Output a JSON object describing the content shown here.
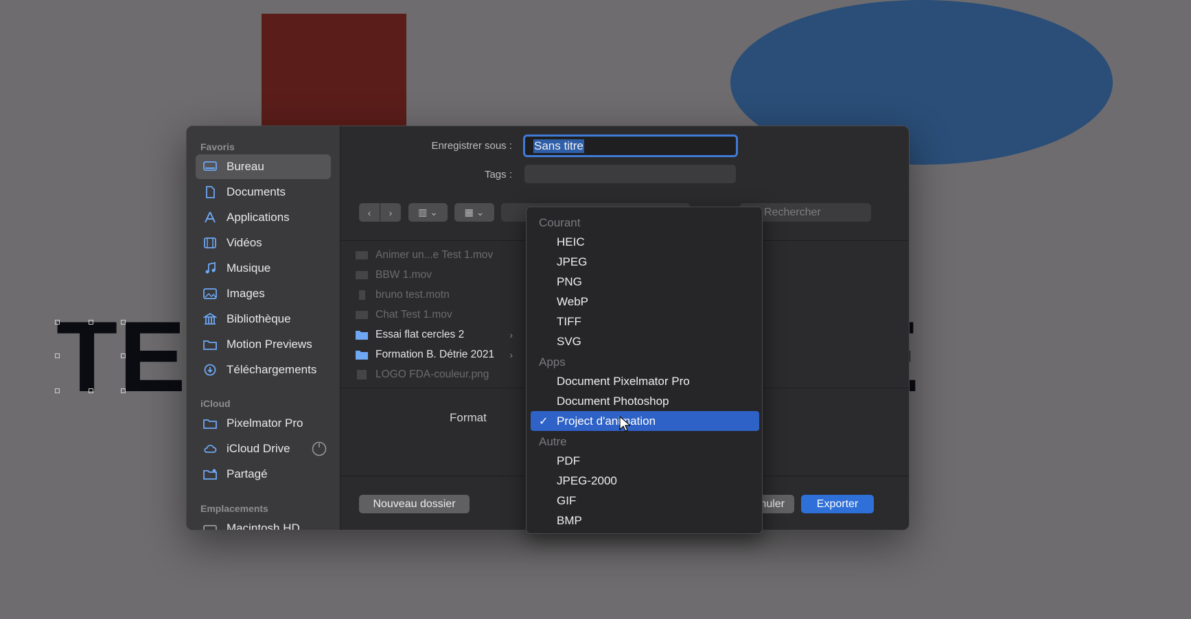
{
  "background": {
    "text_left": "TE",
    "text_right": "ME"
  },
  "dialog": {
    "save_as_label": "Enregistrer sous :",
    "save_as_value": "Sans titre",
    "tags_label": "Tags :",
    "search_placeholder": "Rechercher",
    "format_label": "Format",
    "new_folder_label": "Nouveau dossier",
    "cancel_label": "nnuler",
    "export_label": "Exporter"
  },
  "sidebar": {
    "favorites_header": "Favoris",
    "favorites": [
      {
        "label": "Bureau",
        "icon": "desktop-icon",
        "active": true
      },
      {
        "label": "Documents",
        "icon": "document-icon"
      },
      {
        "label": "Applications",
        "icon": "applications-icon"
      },
      {
        "label": "Vidéos",
        "icon": "film-icon"
      },
      {
        "label": "Musique",
        "icon": "music-icon"
      },
      {
        "label": "Images",
        "icon": "image-icon"
      },
      {
        "label": "Bibliothèque",
        "icon": "library-icon"
      },
      {
        "label": "Motion Previews",
        "icon": "folder-icon"
      },
      {
        "label": "Téléchargements",
        "icon": "download-icon"
      }
    ],
    "icloud_header": "iCloud",
    "icloud": [
      {
        "label": "Pixelmator Pro",
        "icon": "folder-icon"
      },
      {
        "label": "iCloud Drive",
        "icon": "cloud-icon"
      },
      {
        "label": "Partagé",
        "icon": "shared-folder-icon"
      }
    ],
    "locations_header": "Emplacements",
    "locations": [
      {
        "label": "Macintosh HD",
        "icon": "disk-icon"
      }
    ]
  },
  "files": [
    {
      "name": "Animer un...e Test 1.mov",
      "type": "file"
    },
    {
      "name": "BBW 1.mov",
      "type": "file"
    },
    {
      "name": "bruno test.motn",
      "type": "file"
    },
    {
      "name": "Chat Test 1.mov",
      "type": "file"
    },
    {
      "name": "Essai flat cercles 2",
      "type": "folder"
    },
    {
      "name": "Formation B. Détrie 2021",
      "type": "folder"
    },
    {
      "name": "LOGO FDA-couleur.png",
      "type": "file"
    }
  ],
  "format_menu": {
    "section_current": "Courant",
    "current": [
      "HEIC",
      "JPEG",
      "PNG",
      "WebP",
      "TIFF",
      "SVG"
    ],
    "section_apps": "Apps",
    "apps": [
      "Document Pixelmator Pro",
      "Document Photoshop",
      "Project d'animation"
    ],
    "selected": "Project d'animation",
    "check_mark": "✓",
    "section_other": "Autre",
    "other": [
      "PDF",
      "JPEG-2000",
      "GIF",
      "BMP"
    ]
  },
  "colors": {
    "accent": "#2f6fd8",
    "menu_selected": "#2f62c6"
  }
}
